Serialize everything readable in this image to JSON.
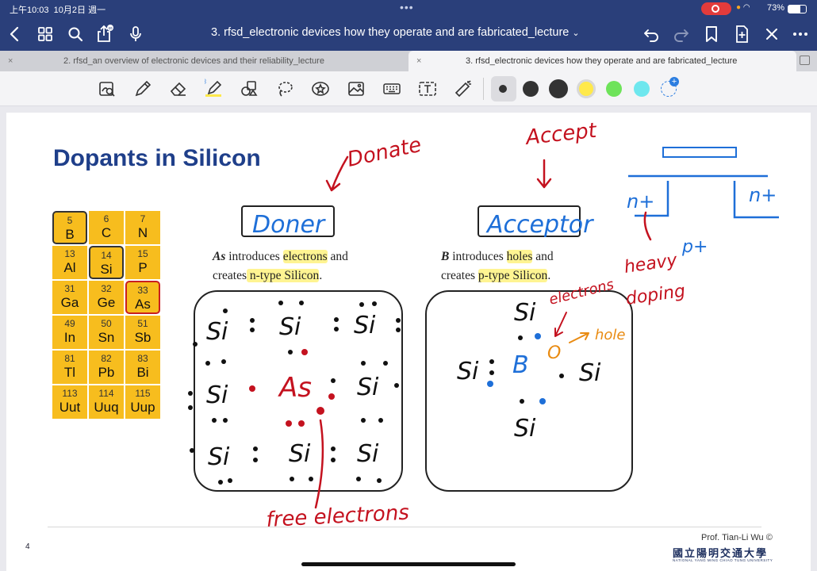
{
  "status": {
    "time": "上午10:03",
    "date": "10月2日 週一",
    "battery": "73%"
  },
  "nav": {
    "title": "3. rfsd_electronic devices how they operate and are fabricated_lecture",
    "title_chevron": "⌄"
  },
  "tabs": [
    {
      "label": "2. rfsd_an overview of electronic devices and their reliability_lecture",
      "close": "×"
    },
    {
      "label": "3. rfsd_electronic devices how they operate and are fabricated_lecture",
      "close": "×"
    }
  ],
  "colors": {
    "accent": "#2a3f7a",
    "title": "#1f3f8a",
    "ink_red": "#c4121f",
    "ink_blue": "#1e6fd8",
    "ink_orange": "#e98b12",
    "highlight": "#fff06e"
  },
  "toolbar": {
    "icons": [
      "zoom-lasso-icon",
      "pen-icon",
      "eraser-icon",
      "highlighter-icon",
      "shapes-icon",
      "lasso-icon",
      "sticker-icon",
      "image-icon",
      "keyboard-icon",
      "text-box-icon",
      "laser-pointer-icon"
    ],
    "swatches": [
      "#333333",
      "#333333",
      "#333333",
      "#ffe94a",
      "#6ee35a",
      "#6ee7ee"
    ]
  },
  "slide": {
    "title": "Dopants in Silicon",
    "page_number": "4",
    "credit": "Prof. Tian-Li Wu ©",
    "university": "國立陽明交通大學",
    "university_en": "NATIONAL YANG MING CHIAO TUNG UNIVERSITY",
    "periodic": [
      {
        "num": "5",
        "sym": "B"
      },
      {
        "num": "6",
        "sym": "C"
      },
      {
        "num": "7",
        "sym": "N"
      },
      {
        "num": "13",
        "sym": "Al"
      },
      {
        "num": "14",
        "sym": "Si"
      },
      {
        "num": "15",
        "sym": "P"
      },
      {
        "num": "31",
        "sym": "Ga"
      },
      {
        "num": "32",
        "sym": "Ge"
      },
      {
        "num": "33",
        "sym": "As"
      },
      {
        "num": "49",
        "sym": "In"
      },
      {
        "num": "50",
        "sym": "Sn"
      },
      {
        "num": "51",
        "sym": "Sb"
      },
      {
        "num": "81",
        "sym": "Tl"
      },
      {
        "num": "82",
        "sym": "Pb"
      },
      {
        "num": "83",
        "sym": "Bi"
      },
      {
        "num": "113",
        "sym": "Uut"
      },
      {
        "num": "114",
        "sym": "Uuq"
      },
      {
        "num": "115",
        "sym": "Uup"
      }
    ],
    "donor": {
      "label": "Doner",
      "line1_em": "As",
      "line1_a": " introduces ",
      "line1_hl": "electrons",
      "line1_b": " and",
      "line2_a": "creates",
      "line2_hl": " n-type Silicon",
      "line2_b": "."
    },
    "acceptor": {
      "label": "Acceptor",
      "line1_em": "B",
      "line1_a": "   introduces  ",
      "line1_hl": "holes",
      "line1_b": "    and",
      "line2_a": "creates ",
      "line2_hl": "p-type Silicon",
      "line2_b": "."
    },
    "annotations": {
      "donate": "Donate",
      "accept": "Accept",
      "free_electrons": "free electrons",
      "electrons": "electrons",
      "hole": "hole",
      "heavy": "heavy",
      "doping": "doping",
      "n_plus_left": "n+",
      "n_plus_right": "n+",
      "p_plus": "p+",
      "si": "Si",
      "as": "As",
      "b": "B",
      "o": "O"
    }
  }
}
